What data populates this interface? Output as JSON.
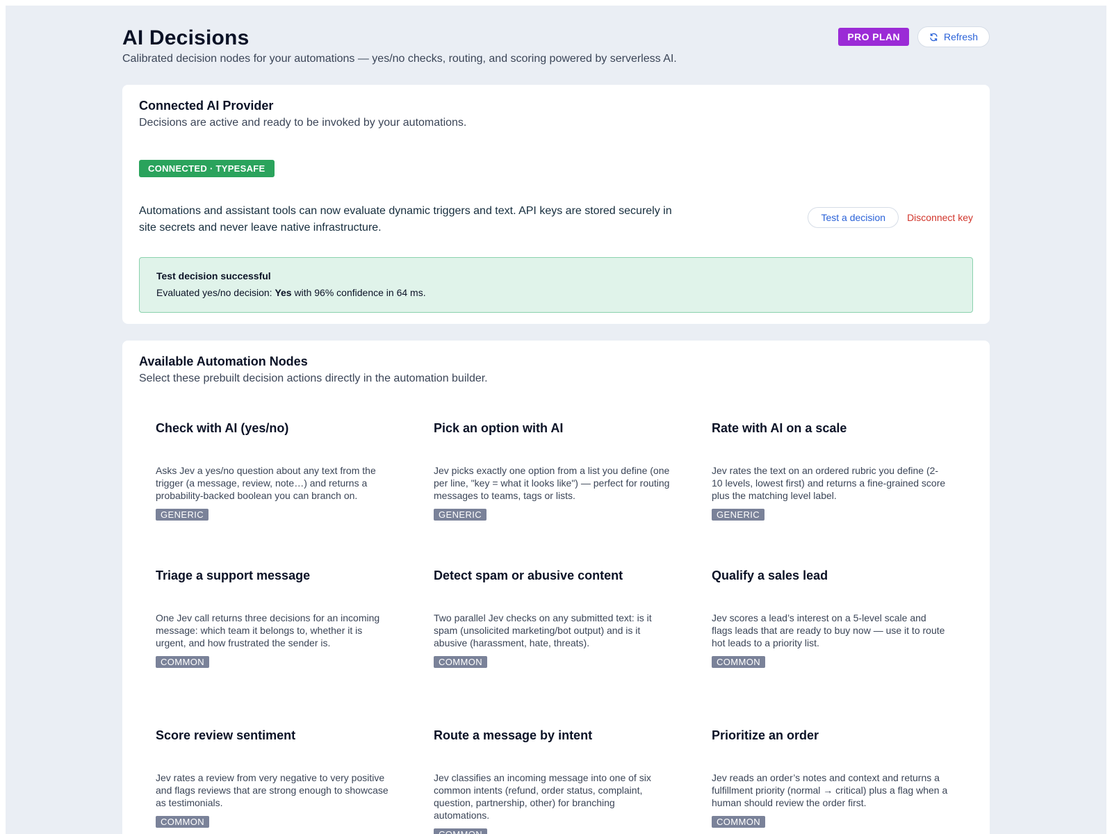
{
  "header": {
    "title": "AI Decisions",
    "subtitle": "Calibrated decision nodes for your automations — yes/no checks, routing, and scoring powered by serverless AI.",
    "plan_badge": "PRO PLAN",
    "refresh_label": "Refresh"
  },
  "provider": {
    "title": "Connected AI Provider",
    "subtitle": "Decisions are active and ready to be invoked by your automations.",
    "status": "CONNECTED · TYPESAFE",
    "description": "Automations and assistant tools can now evaluate dynamic triggers and text. API keys are stored securely in site secrets and never leave native infrastructure.",
    "test_label": "Test a decision",
    "disconnect_label": "Disconnect key",
    "result": {
      "title": "Test decision successful",
      "prefix": "Evaluated yes/no decision: ",
      "answer": "Yes",
      "suffix": " with 96% confidence in 64 ms."
    }
  },
  "nodes_section": {
    "title": "Available Automation Nodes",
    "subtitle": "Select these prebuilt decision actions directly in the automation builder.",
    "nodes": [
      {
        "title": "Check with AI (yes/no)",
        "description": "Asks Jev a yes/no question about any text from the trigger (a message, review, note…) and returns a probability-backed boolean you can branch on.",
        "tag": "GENERIC"
      },
      {
        "title": "Pick an option with AI",
        "description": "Jev picks exactly one option from a list you define (one per line, \"key = what it looks like\") — perfect for routing messages to teams, tags or lists.",
        "tag": "GENERIC"
      },
      {
        "title": "Rate with AI on a scale",
        "description": "Jev rates the text on an ordered rubric you define (2-10 levels, lowest first) and returns a fine-grained score plus the matching level label.",
        "tag": "GENERIC"
      },
      {
        "title": "Triage a support message",
        "description": "One Jev call returns three decisions for an incoming message: which team it belongs to, whether it is urgent, and how frustrated the sender is.",
        "tag": "COMMON"
      },
      {
        "title": "Detect spam or abusive content",
        "description": "Two parallel Jev checks on any submitted text: is it spam (unsolicited marketing/bot output) and is it abusive (harassment, hate, threats).",
        "tag": "COMMON"
      },
      {
        "title": "Qualify a sales lead",
        "description": "Jev scores a lead’s interest on a 5-level scale and flags leads that are ready to buy now — use it to route hot leads to a priority list.",
        "tag": "COMMON"
      },
      {
        "title": "Score review sentiment",
        "description": "Jev rates a review from very negative to very positive and flags reviews that are strong enough to showcase as testimonials.",
        "tag": "COMMON"
      },
      {
        "title": "Route a message by intent",
        "description": "Jev classifies an incoming message into one of six common intents (refund, order status, complaint, question, partnership, other) for branching automations.",
        "tag": "COMMON"
      },
      {
        "title": "Prioritize an order",
        "description": "Jev reads an order’s notes and context and returns a fulfillment priority (normal → critical) plus a flag when a human should review the order first.",
        "tag": "COMMON"
      }
    ]
  },
  "colors": {
    "background": "#eaeef4",
    "accent": "#2a62d8",
    "pro_badge": "#9b2bd6",
    "connected": "#2aa35c",
    "danger": "#d1352b",
    "success_bg": "#e0f3ea",
    "tag": "#7a8299"
  }
}
